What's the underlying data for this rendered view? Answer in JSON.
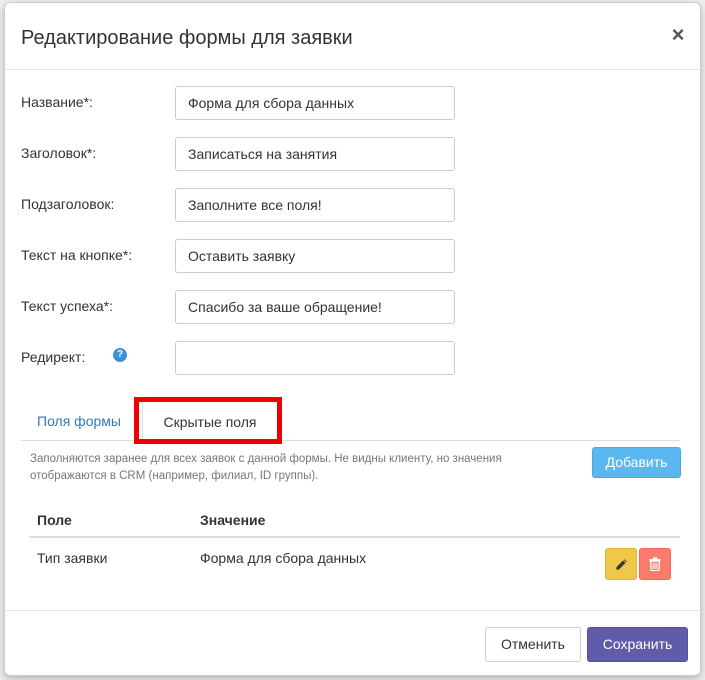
{
  "modal": {
    "title": "Редактирование формы для заявки",
    "close_label": "×"
  },
  "form": {
    "fields": [
      {
        "label": "Название*:",
        "value": "Форма для сбора данных"
      },
      {
        "label": "Заголовок*:",
        "value": "Записаться на занятия"
      },
      {
        "label": "Подзаголовок:",
        "value": "Заполните все поля!"
      },
      {
        "label": "Текст на кнопке*:",
        "value": "Оставить заявку"
      },
      {
        "label": "Текст успеха*:",
        "value": "Спасибо за ваше обращение!"
      },
      {
        "label": "Редирект:",
        "value": ""
      }
    ],
    "help_icon": "question-circle-icon"
  },
  "tabs": {
    "form_fields": "Поля формы",
    "hidden_fields": "Скрытые поля",
    "active": "hidden_fields"
  },
  "hidden": {
    "hint": "Заполняются заранее для всех заявок с данной формы. Не видны клиенту, но значения отображаются в CRM (например, филиал, ID группы).",
    "add_label": "Добавить",
    "columns": {
      "field": "Поле",
      "value": "Значение"
    },
    "rows": [
      {
        "field": "Тип заявки",
        "value": "Форма для сбора данных"
      }
    ]
  },
  "footer": {
    "cancel_label": "Отменить",
    "save_label": "Сохранить"
  },
  "colors": {
    "primary": "#605ca8",
    "info": "#5bb8ef",
    "warning": "#efc84a",
    "danger": "#fb7c6b",
    "highlight": "#ee0000"
  }
}
